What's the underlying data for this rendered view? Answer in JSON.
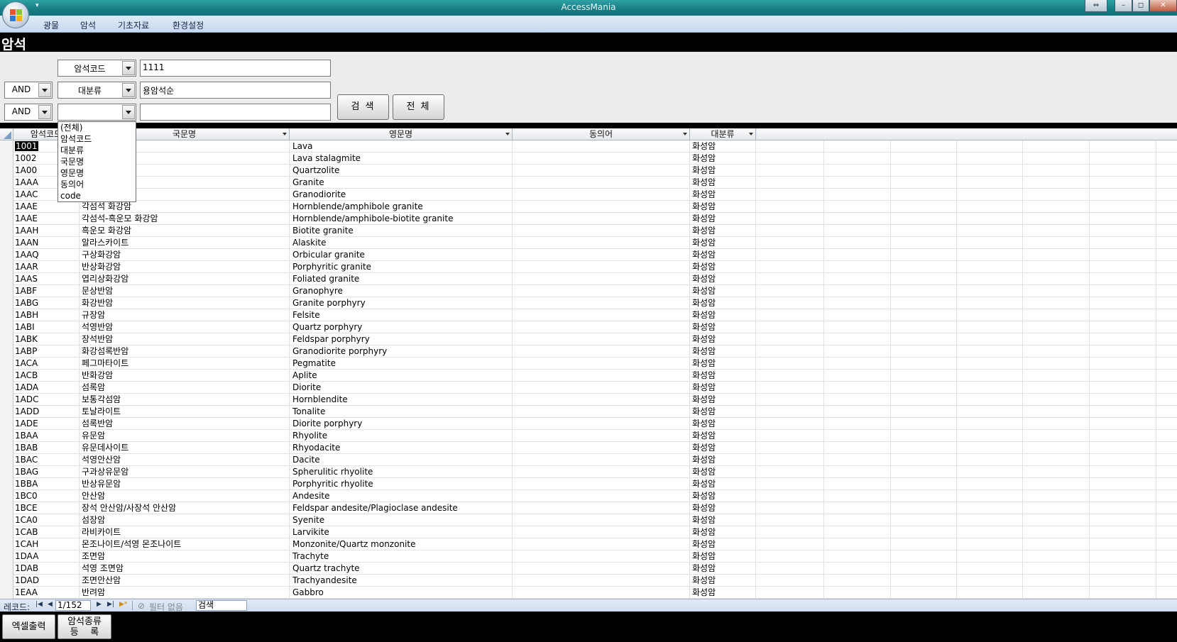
{
  "window": {
    "title": "AccessMania",
    "qat_arrow": "▾",
    "restore_icon": "⇔",
    "minimize_icon": "–",
    "maximize_icon": "◻",
    "close_icon": "✕"
  },
  "menu": [
    "광물",
    "암석",
    "기초자료",
    "환경설정"
  ],
  "form": {
    "title": "암석"
  },
  "search": {
    "row1": {
      "field": "암석코드",
      "value": "1111"
    },
    "row2": {
      "op": "AND",
      "field": "대분류",
      "value": "용암석순"
    },
    "row3": {
      "op": "AND",
      "field": "",
      "value": ""
    },
    "search_button": "검 색",
    "all_button": "전 체"
  },
  "dropdown": [
    "(전체)",
    "암석코드",
    "대분류",
    "국문명",
    "영문명",
    "동의어",
    "code"
  ],
  "grid": {
    "columns": [
      "암석코드",
      "국문명",
      "영문명",
      "동의어",
      "대분류"
    ],
    "rows": [
      [
        "1001",
        "",
        "Lava",
        "",
        "화성암"
      ],
      [
        "1002",
        "",
        "Lava stalagmite",
        "",
        "화성암"
      ],
      [
        "1A00",
        "",
        "Quartzolite",
        "",
        "화성암"
      ],
      [
        "1AAA",
        "",
        "Granite",
        "",
        "화성암"
      ],
      [
        "1AAC",
        "",
        "Granodiorite",
        "",
        "화성암"
      ],
      [
        "1AAE",
        "각섬석 화강암",
        "Hornblende/amphibole granite",
        "",
        "화성암"
      ],
      [
        "1AAE",
        "각섬석-흑운모 화강암",
        "Hornblende/amphibole-biotite granite",
        "",
        "화성암"
      ],
      [
        "1AAH",
        "흑운모 화강암",
        "Biotite granite",
        "",
        "화성암"
      ],
      [
        "1AAN",
        "알라스카이트",
        "Alaskite",
        "",
        "화성암"
      ],
      [
        "1AAQ",
        "구상화강암",
        "Orbicular granite",
        "",
        "화성암"
      ],
      [
        "1AAR",
        "반상화강암",
        "Porphyritic granite",
        "",
        "화성암"
      ],
      [
        "1AAS",
        "엽리상화강암",
        "Foliated granite",
        "",
        "화성암"
      ],
      [
        "1ABF",
        "문상반암",
        "Granophyre",
        "",
        "화성암"
      ],
      [
        "1ABG",
        "화강반암",
        "Granite porphyry",
        "",
        "화성암"
      ],
      [
        "1ABH",
        "규장암",
        "Felsite",
        "",
        "화성암"
      ],
      [
        "1ABI",
        "석영반암",
        "Quartz porphyry",
        "",
        "화성암"
      ],
      [
        "1ABK",
        "장석반암",
        "Feldspar porphyry",
        "",
        "화성암"
      ],
      [
        "1ABP",
        "화강섬록반암",
        "Granodiorite porphyry",
        "",
        "화성암"
      ],
      [
        "1ACA",
        "페그마타이트",
        "Pegmatite",
        "",
        "화성암"
      ],
      [
        "1ACB",
        "반화강암",
        "Aplite",
        "",
        "화성암"
      ],
      [
        "1ADA",
        "섬록암",
        "Diorite",
        "",
        "화성암"
      ],
      [
        "1ADC",
        "보통각섬암",
        "Hornblendite",
        "",
        "화성암"
      ],
      [
        "1ADD",
        "토날라이트",
        "Tonalite",
        "",
        "화성암"
      ],
      [
        "1ADE",
        "섬록반암",
        "Diorite porphyry",
        "",
        "화성암"
      ],
      [
        "1BAA",
        "유문암",
        "Rhyolite",
        "",
        "화성암"
      ],
      [
        "1BAB",
        "유문데사이트",
        "Rhyodacite",
        "",
        "화성암"
      ],
      [
        "1BAC",
        "석영안산암",
        "Dacite",
        "",
        "화성암"
      ],
      [
        "1BAG",
        "구과상유문암",
        "Spherulitic rhyolite",
        "",
        "화성암"
      ],
      [
        "1BBA",
        "반상유문암",
        "Porphyritic rhyolite",
        "",
        "화성암"
      ],
      [
        "1BC0",
        "안산암",
        "Andesite",
        "",
        "화성암"
      ],
      [
        "1BCE",
        "장석 안산암/사장석 안산암",
        "Feldspar andesite/Plagioclase andesite",
        "",
        "화성암"
      ],
      [
        "1CA0",
        "섬장암",
        "Syenite",
        "",
        "화성암"
      ],
      [
        "1CAB",
        "라비카이트",
        "Larvikite",
        "",
        "화성암"
      ],
      [
        "1CAH",
        "몬조나이트/석영 몬조나이트",
        "Monzonite/Quartz monzonite",
        "",
        "화성암"
      ],
      [
        "1DAA",
        "조면암",
        "Trachyte",
        "",
        "화성암"
      ],
      [
        "1DAB",
        "석영 조면암",
        "Quartz trachyte",
        "",
        "화성암"
      ],
      [
        "1DAD",
        "조면안산암",
        "Trachyandesite",
        "",
        "화성암"
      ],
      [
        "1EAA",
        "반려암",
        "Gabbro",
        "",
        "화성암"
      ]
    ]
  },
  "navbar": {
    "record_label": "레코드:",
    "position": "1/152",
    "filter_label": "필터 없음",
    "search_label": "검색",
    "first_icon": "|◀",
    "prev_icon": "◀",
    "next_icon": "▶",
    "last_icon": "▶|",
    "new_icon": "▶*"
  },
  "footer": {
    "excel_button": "엑셀출력",
    "register_line1": "암석종류",
    "register_line2": "등    록"
  }
}
